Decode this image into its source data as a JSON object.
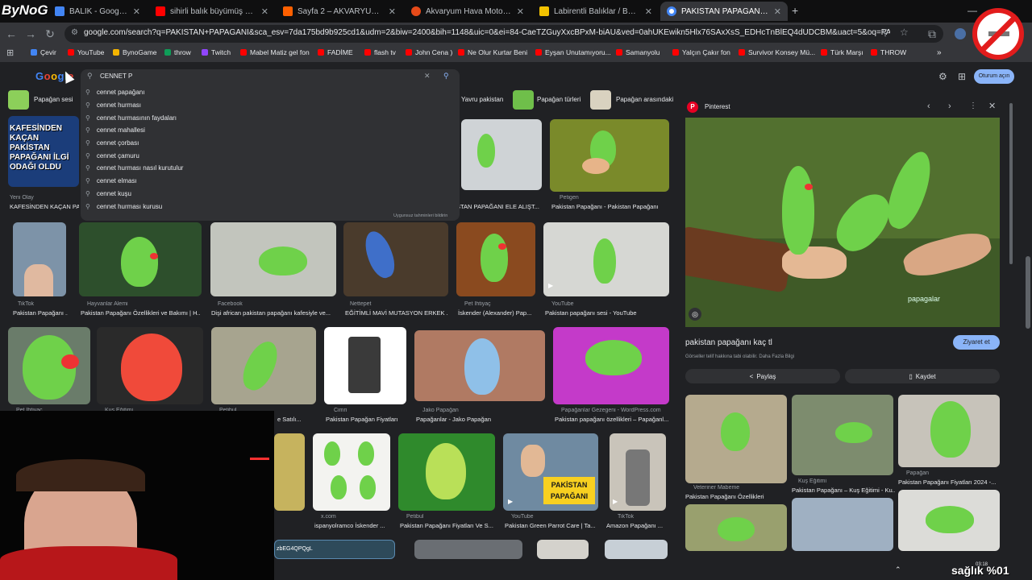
{
  "brand_overlay": "ByNoG",
  "tabs": [
    {
      "label": "BALIK - Google'da Ara",
      "color": "#4285f4"
    },
    {
      "label": "sihirli balık büyümüş hali - You",
      "color": "#ff0000"
    },
    {
      "label": "Sayfa 2 – AKVARYUM - Hepsib",
      "color": "#ff6000"
    },
    {
      "label": "Akvaryum Hava Motoru Fiyatı",
      "color": "#e64a19"
    },
    {
      "label": "Labirentli Balıklar / Betta / HAL",
      "color": "#f2c200"
    },
    {
      "label": "PAKİSTAN PAPAGANI - Google",
      "color": "#4285f4"
    }
  ],
  "new_tab": "+",
  "address": {
    "url": "google.com/search?q=PAKİSTAN+PAPAGANI&sca_esv=7da175bd9b925cd1&udm=2&biw=2400&bih=1148&uic=0&ei=84-CaeTZGuyXxcBPxM-biAU&ved=0ahUKEwikn5Hlx76SAxXsS_EDHcTnBlEQ4dUDCBM&uact=5&oq=PAKİSTAN+PAP..."
  },
  "bookmarks": [
    {
      "label": "Çevir",
      "color": "#4285f4"
    },
    {
      "label": "YouTube",
      "color": "#ff0000"
    },
    {
      "label": "BynoGame",
      "color": "#f4b400"
    },
    {
      "label": "throw",
      "color": "#0f9d58"
    },
    {
      "label": "Twitch",
      "color": "#9146ff"
    },
    {
      "label": "Mabel Matiz gel fon",
      "color": "#ff0000"
    },
    {
      "label": "FADİME",
      "color": "#ff0000"
    },
    {
      "label": "flash tv",
      "color": "#ff0000"
    },
    {
      "label": "John Cena )",
      "color": "#ff0000"
    },
    {
      "label": "Ne Olur Kurtar Beni",
      "color": "#ff0000"
    },
    {
      "label": "Eyşan Unutamıyoru...",
      "color": "#ff0000"
    },
    {
      "label": "Samanyolu",
      "color": "#ff0000"
    },
    {
      "label": "Yalçın Çakır fon",
      "color": "#ff0000"
    },
    {
      "label": "Survivor Konsey Mü...",
      "color": "#ff0000"
    },
    {
      "label": "Türk Marşı",
      "color": "#ff0000"
    },
    {
      "label": "THROW",
      "color": "#ff0000"
    }
  ],
  "search": {
    "query": "CENNET P"
  },
  "suggestions": [
    "cennet papağanı",
    "cennet hurması",
    "cennet hurmasının faydaları",
    "cennet mahallesi",
    "cennet çorbası",
    "cennet çamuru",
    "cennet hurması nasıl kurutulur",
    "cennet elması",
    "cennet kuşu",
    "cennet hurması kurusu"
  ],
  "suggestions_footer": "Uygunsuz tahminleri bildirin",
  "signin": "Oturum açın",
  "chips": [
    "Papağan sesi",
    "Yavru pakistan",
    "Papağan türleri",
    "Papağan arasındaki"
  ],
  "results": [
    {
      "source": "Yeni Olay",
      "title": "KAFESİNDEN KAÇAN PAK...",
      "headline": "KAFESİNDEN KAÇAN PAKİSTAN PAPAĞANI İLGİ ODAĞI OLDU"
    },
    {
      "source": "",
      "title": "STAN PAPAĞANI ELE ALIŞT..."
    },
    {
      "source": "Petigen",
      "title": "Pakistan Papağanı - Pakistan Papağanı"
    },
    {
      "source": "TikTok",
      "title": "Pakistan Papağanı ..."
    },
    {
      "source": "Hayvanlar Alemi",
      "title": "Pakistan Papağanı Özellikleri ve Bakımı | H..."
    },
    {
      "source": "Facebook",
      "title": "Dişi african pakistan papağanı kafesiyle ve..."
    },
    {
      "source": "Nettepet",
      "title": "EĞİTİMLİ MAVİ MUTASYON ERKEK ..."
    },
    {
      "source": "Pet İhtiyaç",
      "title": "İskender (Alexander) Pap..."
    },
    {
      "source": "YouTube",
      "title": "Pakistan papağanı sesi - YouTube"
    },
    {
      "source": "Pet İhtiyaç",
      "title": ""
    },
    {
      "source": "Kuş Eğitimi",
      "title": ""
    },
    {
      "source": "Petibul",
      "title": "e Satılı..."
    },
    {
      "source": "Cimri",
      "title": "Pakistan Papağan Fiyatları"
    },
    {
      "source": "Jako Papağan",
      "title": "Papağanlar - Jako Papağan"
    },
    {
      "source": "Papağanlar Gezegeni - WordPress.com",
      "title": "Pakistan papağanı özellikleri – Papağanl..."
    },
    {
      "source": "x.com",
      "title": "ispanyolramco İskender ..."
    },
    {
      "source": "Petibul",
      "title": "Pakistan Papağanı Fiyatları Ve S..."
    },
    {
      "source": "YouTube",
      "title": "Pakistan Green Parrot Care | Ta..."
    },
    {
      "source": "TikTok",
      "title": "Amazon Papağanı ..."
    }
  ],
  "video_badge": "PAKİSTAN PAPAĞANI",
  "bottom_text": "zbEG4QPQgL",
  "panel": {
    "source": "Pinterest",
    "title": "pakistan papağanı kaç tl",
    "visit": "Ziyaret et",
    "copyright": "Görseller telif hakkına tabi olabilir. Daha Fazla Bilgi",
    "share": "Paylaş",
    "save": "Kaydet",
    "watermark": "papagalar",
    "related": [
      {
        "source": "Veteriner Mabeme",
        "title": "Pakistan Papağanı Özellikleri"
      },
      {
        "source": "Kuş Eğitimi",
        "title": "Pakistan Papağanı – Kuş Eğitimi - Ku..."
      },
      {
        "source": "Papağan",
        "title": "Pakistan Papağanı Fiyatları 2024 -..."
      }
    ]
  },
  "overlay_bottom_right": "sağlık %01",
  "taskbar_time": "03:18"
}
